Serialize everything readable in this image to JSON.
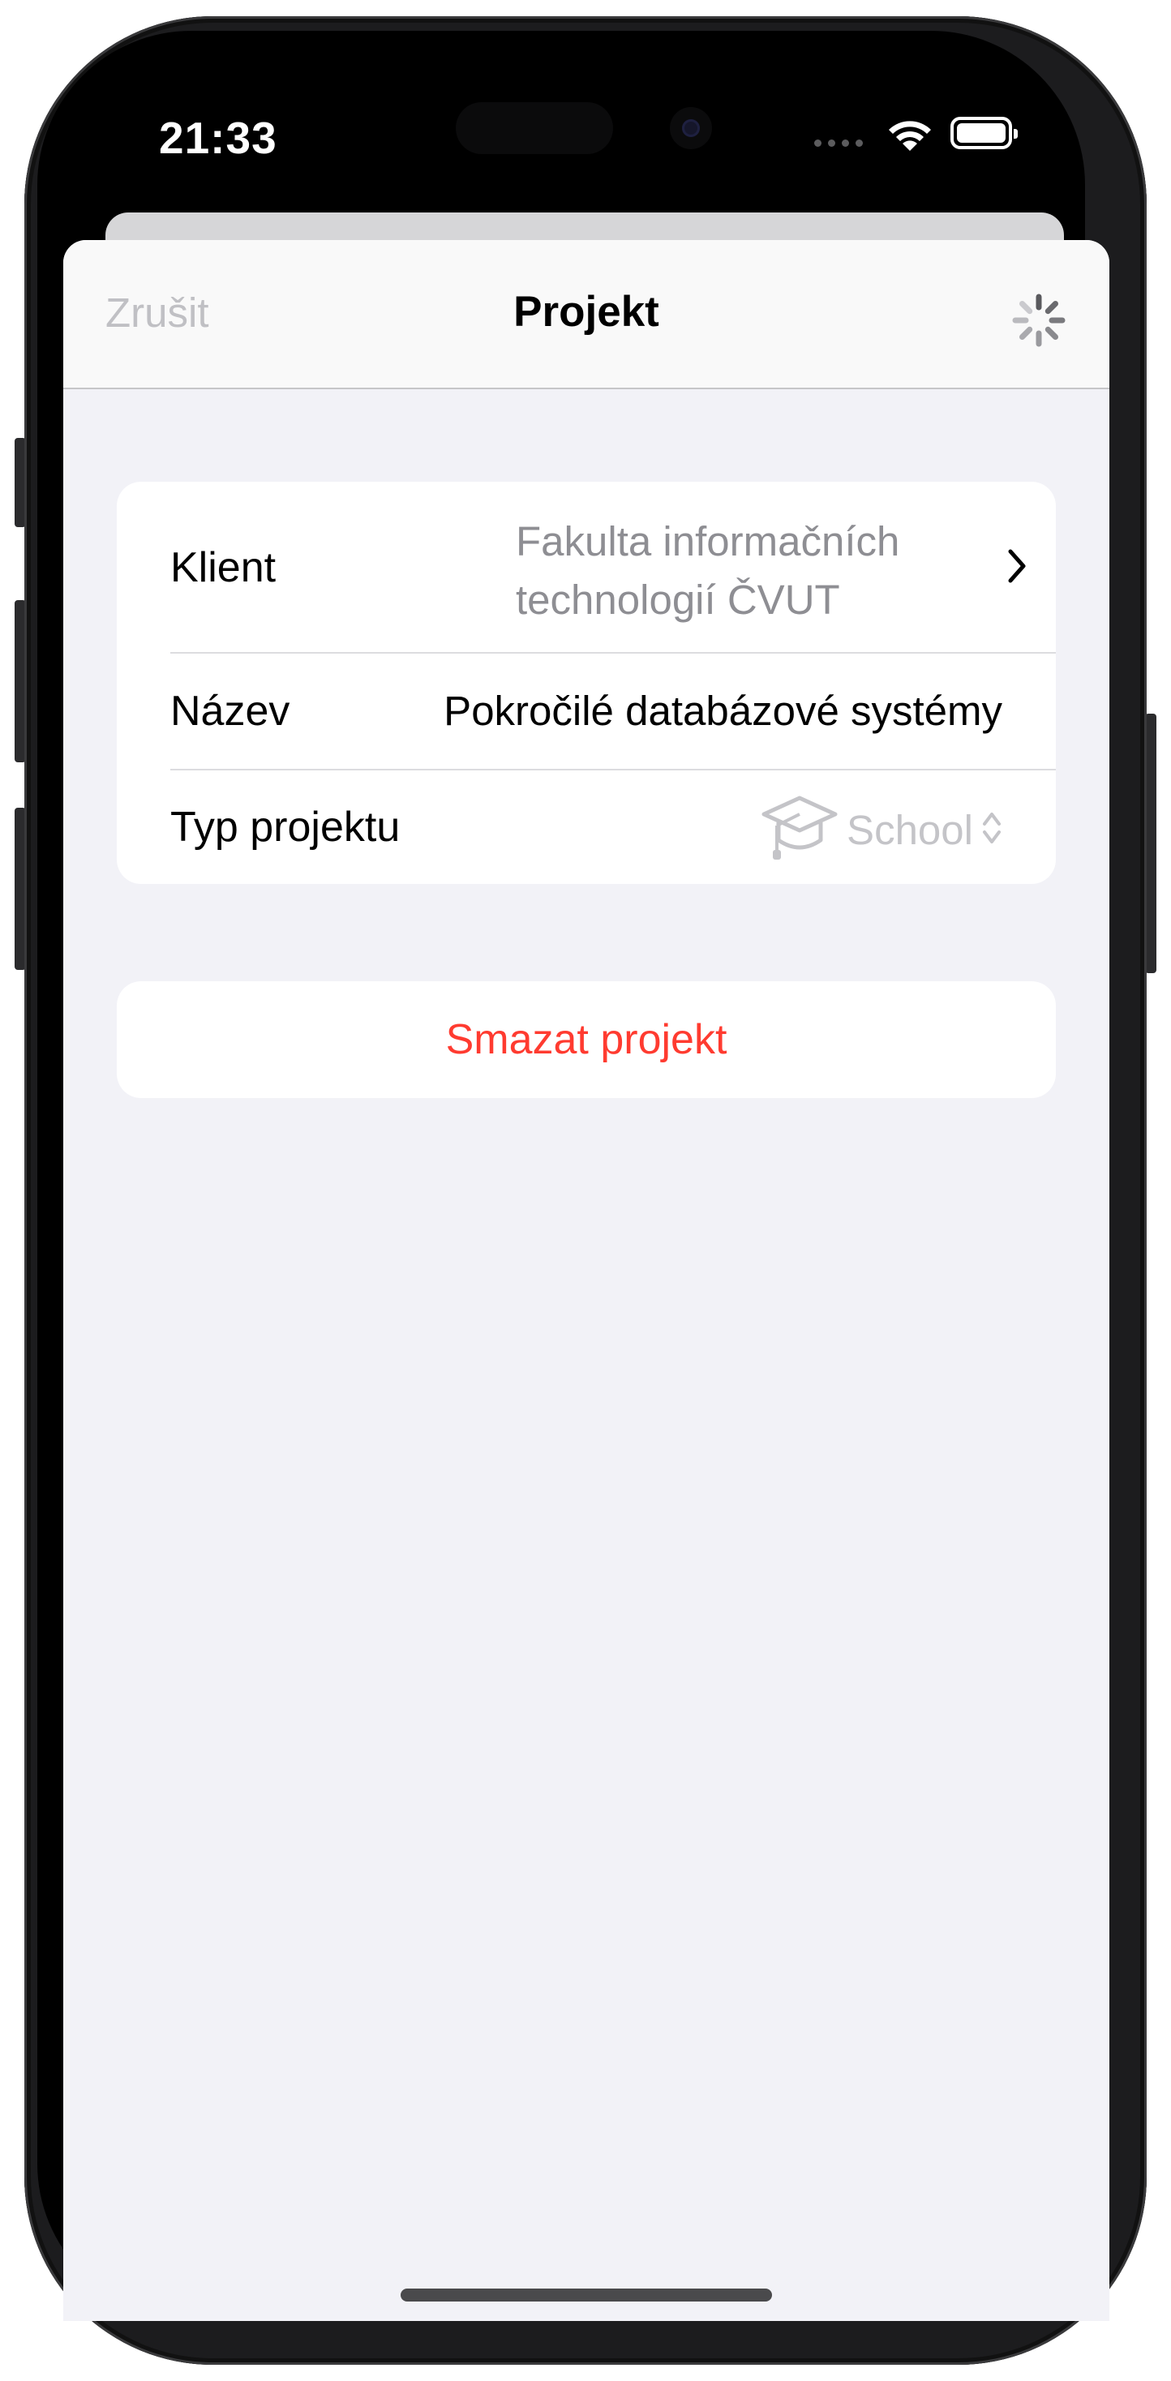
{
  "status_bar": {
    "time": "21:33"
  },
  "nav": {
    "cancel_label": "Zrušit",
    "title": "Projekt",
    "activity_icon": "loading-spinner-icon"
  },
  "form": {
    "client": {
      "label": "Klient",
      "value_line1": "Fakulta informačních",
      "value_line2": "technologií ČVUT"
    },
    "name": {
      "label": "Název",
      "value": "Pokročilé databázové systémy"
    },
    "project_type": {
      "label": "Typ projektu",
      "icon": "graduation-cap-icon",
      "value": "School"
    }
  },
  "delete_button": {
    "label": "Smazat projekt"
  },
  "colors": {
    "destructive": "#ff3b30",
    "background": "#f2f2f7",
    "secondary_text": "#8e8e93"
  }
}
